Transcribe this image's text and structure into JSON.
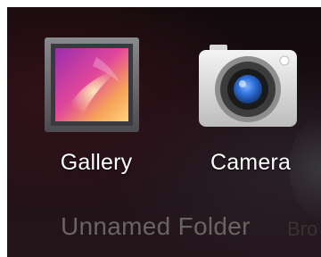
{
  "apps": [
    {
      "label": "Gallery",
      "icon": "gallery-icon"
    },
    {
      "label": "Camera",
      "icon": "camera-icon"
    }
  ],
  "folder": {
    "name": "Unnamed Folder",
    "next_folder_partial": "Bro"
  },
  "colors": {
    "background": "#1c0f14",
    "folder_name": "#6b6466",
    "label": "#ffffff",
    "camera_lens": "#2e6fd8"
  }
}
